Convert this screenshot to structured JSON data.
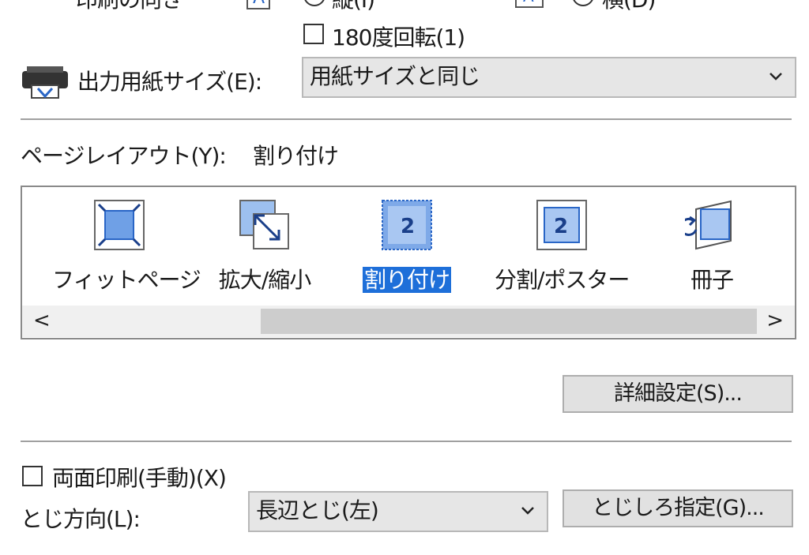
{
  "orientation": {
    "label": "印刷の向き",
    "portrait_label": "縦(I)",
    "landscape_label": "横(D)",
    "selected": "landscape",
    "rotate_label": "180度回転(1)"
  },
  "output_paper": {
    "label": "出力用紙サイズ(E):",
    "value": "用紙サイズと同じ"
  },
  "page_layout": {
    "label": "ページレイアウト(Y):",
    "value": "割り付け",
    "items": [
      {
        "label": "フィットページ",
        "icon": "fit-page-icon"
      },
      {
        "label": "拡大/縮小",
        "icon": "scale-icon"
      },
      {
        "label": "割り付け",
        "icon": "page-layout-icon"
      },
      {
        "label": "分割/ポスター",
        "icon": "tiling-poster-icon"
      },
      {
        "label": "冊子",
        "icon": "booklet-icon"
      }
    ],
    "selected_index": 2,
    "scroll_left": "<",
    "scroll_right": ">"
  },
  "details_button": "詳細設定(S)...",
  "duplex": {
    "label": "両面印刷(手動)(X)",
    "checked": false
  },
  "binding": {
    "label": "とじ方向(L):",
    "value": "長辺とじ(左)",
    "margin_button": "とじしろ指定(G)..."
  },
  "colors": {
    "selection": "#1e6fd9",
    "icon_blue": "#2a66c6",
    "button_bg": "#e1e1e1"
  }
}
